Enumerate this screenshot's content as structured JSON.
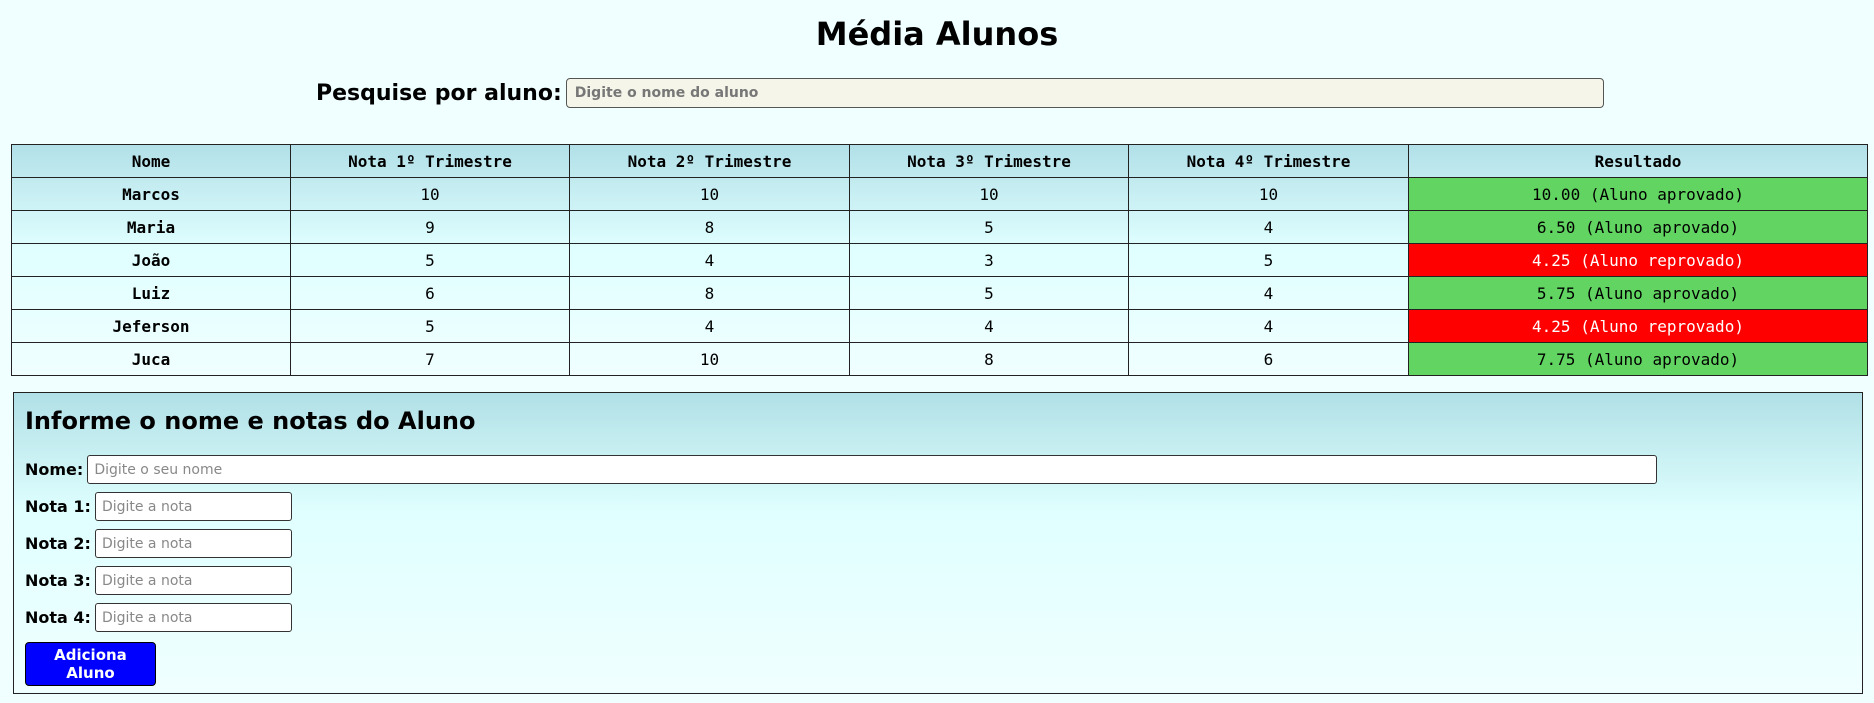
{
  "page": {
    "title": "Média Alunos"
  },
  "search": {
    "label": "Pesquise por aluno:",
    "placeholder": "Digite o nome do aluno",
    "value": ""
  },
  "table": {
    "headers": [
      "Nome",
      "Nota 1º Trimestre",
      "Nota 2º Trimestre",
      "Nota 3º Trimestre",
      "Nota 4º Trimestre",
      "Resultado"
    ],
    "rows": [
      {
        "name": "Marcos",
        "n1": "10",
        "n2": "10",
        "n3": "10",
        "n4": "10",
        "result": "10.00 (Aluno aprovado)",
        "status": "approved"
      },
      {
        "name": "Maria",
        "n1": "9",
        "n2": "8",
        "n3": "5",
        "n4": "4",
        "result": "6.50 (Aluno aprovado)",
        "status": "approved"
      },
      {
        "name": "João",
        "n1": "5",
        "n2": "4",
        "n3": "3",
        "n4": "5",
        "result": "4.25 (Aluno reprovado)",
        "status": "failed"
      },
      {
        "name": "Luiz",
        "n1": "6",
        "n2": "8",
        "n3": "5",
        "n4": "4",
        "result": "5.75 (Aluno aprovado)",
        "status": "approved"
      },
      {
        "name": "Jeferson",
        "n1": "5",
        "n2": "4",
        "n3": "4",
        "n4": "4",
        "result": "4.25 (Aluno reprovado)",
        "status": "failed"
      },
      {
        "name": "Juca",
        "n1": "7",
        "n2": "10",
        "n3": "8",
        "n4": "6",
        "result": "7.75 (Aluno aprovado)",
        "status": "approved"
      }
    ]
  },
  "form": {
    "heading": "Informe o nome e notas do Aluno",
    "name_label": "Nome:",
    "name_placeholder": "Digite o seu nome",
    "nota1_label": "Nota 1:",
    "nota2_label": "Nota 2:",
    "nota3_label": "Nota 3:",
    "nota4_label": "Nota 4:",
    "nota_placeholder": "Digite a nota",
    "submit_label": "Adiciona Aluno"
  },
  "colors": {
    "approved": "#62d462",
    "failed": "#ff0000",
    "button": "#0000ff"
  }
}
